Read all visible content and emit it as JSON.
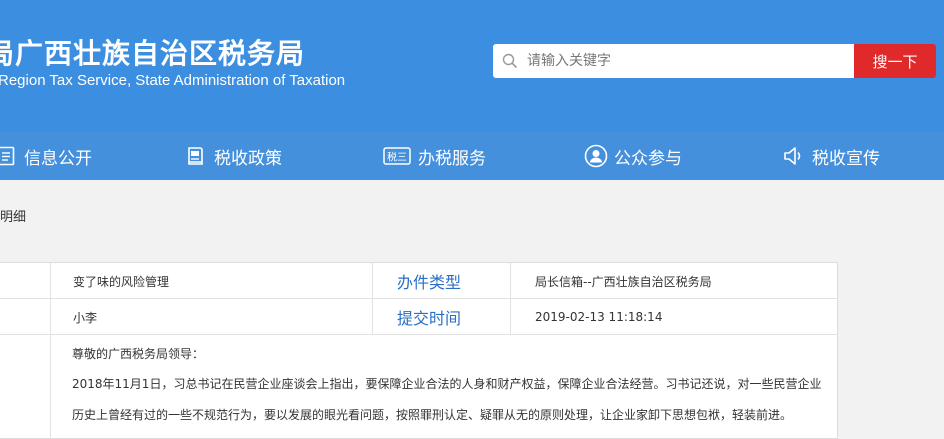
{
  "header": {
    "title_cn": "局广西壮族自治区税务局",
    "title_en": "Region Tax Service, State Administration of Taxation"
  },
  "search": {
    "placeholder": "请输入关键字",
    "button_label": "搜一下"
  },
  "nav": {
    "items": [
      {
        "label": "信息公开",
        "icon": "document-icon"
      },
      {
        "label": "税收政策",
        "icon": "book-icon"
      },
      {
        "label": "办税服务",
        "icon": "tax-badge-icon"
      },
      {
        "label": "公众参与",
        "icon": "user-circle-icon"
      },
      {
        "label": "税收宣传",
        "icon": "speaker-icon"
      }
    ]
  },
  "breadcrumb": {
    "text": "明细"
  },
  "detail": {
    "subject": "变了味的风险管理",
    "type_label": "办件类型",
    "type_value": "局长信箱--广西壮族自治区税务局",
    "sender": "小李",
    "time_label": "提交时间",
    "time_value": "2019-02-13 11:18:14",
    "greeting": "尊敬的广西税务局领导：",
    "para1": "2018年11月1日，习总书记在民营企业座谈会上指出，要保障企业合法的人身和财产权益，保障企业合法经营。习书记还说，对一些民营企业",
    "para2": "历史上曾经有过的一些不规范行为，要以发展的眼光看问题，按照罪刑认定、疑罪从无的原则处理，让企业家卸下思想包袱，轻装前进。"
  },
  "colors": {
    "header_bg": "#3c8ee0",
    "nav_bg": "#4590dc",
    "search_button": "#e0292a",
    "label_text": "#2a6fc4"
  }
}
